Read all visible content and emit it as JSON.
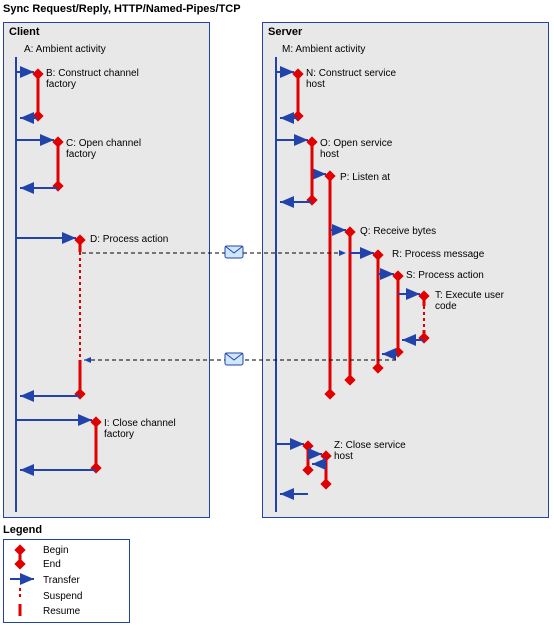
{
  "title": "Sync Request/Reply, HTTP/Named-Pipes/TCP",
  "client": {
    "title": "Client",
    "A": "A: Ambient activity",
    "B": "B: Construct channel factory",
    "C": "C: Open channel factory",
    "D": "D: Process action",
    "I": "I: Close channel factory"
  },
  "server": {
    "title": "Server",
    "M": "M: Ambient activity",
    "N": "N: Construct service host",
    "O": "O: Open service host",
    "P": "P: Listen at",
    "Q": "Q: Receive bytes",
    "R": "R: Process message",
    "S": "S: Process action",
    "T": "T: Execute user code",
    "Z": "Z: Close service host"
  },
  "legend": {
    "title": "Legend",
    "begin": "Begin",
    "end": "End",
    "transfer": "Transfer",
    "suspend": "Suspend",
    "resume": "Resume"
  },
  "colors": {
    "red": "#e00000",
    "blue": "#2244aa",
    "panel": "#e8e8e8"
  }
}
